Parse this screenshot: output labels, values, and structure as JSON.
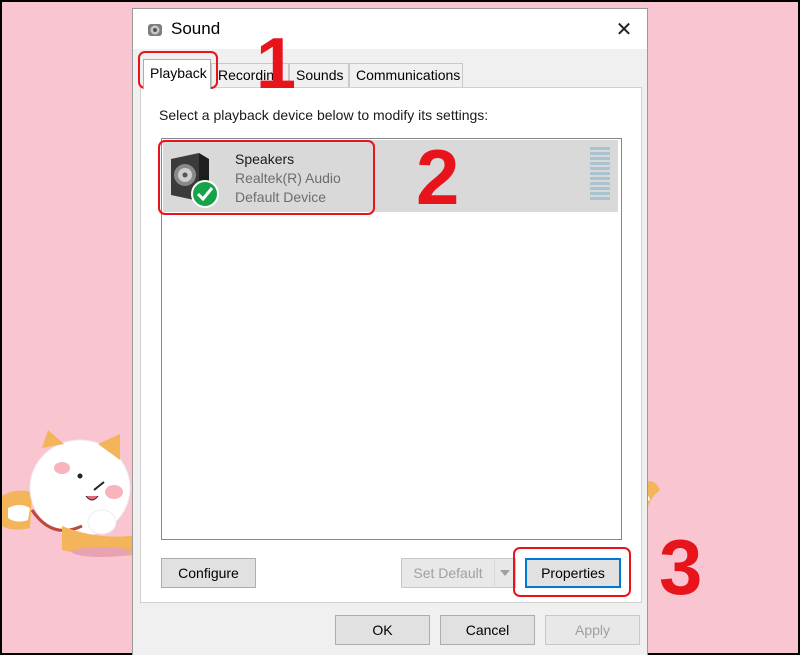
{
  "window": {
    "title": "Sound",
    "icon": "speaker-icon",
    "close_glyph": "✕"
  },
  "tabs": [
    {
      "label": "Playback",
      "active": true
    },
    {
      "label": "Recording",
      "active": false
    },
    {
      "label": "Sounds",
      "active": false
    },
    {
      "label": "Communications",
      "active": false
    }
  ],
  "panel": {
    "instruction": "Select a playback device below to modify its settings:"
  },
  "devices": [
    {
      "name": "Speakers",
      "driver": "Realtek(R) Audio",
      "status": "Default Device",
      "icon": "speaker-icon",
      "badge_icon": "checkmark-icon",
      "selected": true
    }
  ],
  "panel_buttons": {
    "configure": "Configure",
    "set_default": "Set Default",
    "properties": "Properties"
  },
  "dialog_buttons": {
    "ok": "OK",
    "cancel": "Cancel",
    "apply": "Apply"
  },
  "annotations": {
    "step1": "1",
    "step2": "2",
    "step3": "3"
  },
  "colors": {
    "background": "#f8c5d1",
    "annotation_red": "#e8141c",
    "selection": "#d9d9d9",
    "focus_blue": "#0078d7",
    "check_green": "#16a34a"
  }
}
